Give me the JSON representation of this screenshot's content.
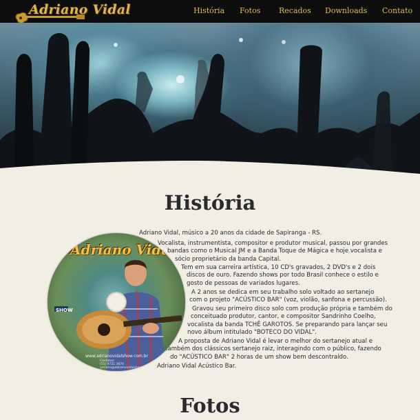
{
  "brand": {
    "name": "Adriano Vidal"
  },
  "nav": {
    "items": [
      {
        "label": "História"
      },
      {
        "label": "Fotos"
      },
      {
        "label": "Recados"
      },
      {
        "label": "Downloads"
      },
      {
        "label": "Contato"
      }
    ]
  },
  "hero": {
    "description": "Concert crowd silhouettes with hands raised, band on stage under lights"
  },
  "historia": {
    "title": "História",
    "intro": "Adriano Vidal, músico a 20 anos da cidade de Sapiranga - RS.",
    "p1": [
      "Vocalista, instrumentista, compositor e produtor musical, passou por grandes",
      "bandas como o Musical JM e a Banda Toque de Mágica e hoje vocalista e",
      "sócio proprietário da banda Capital."
    ],
    "p2": [
      "Tem em sua carreira artística, 10 CD's gravados, 2 DVD's e 2 dois",
      "discos de ouro. Fazendo shows por todo Brasil conhece o estilo e",
      "gosto de pessoas de variados lugares."
    ],
    "p3": [
      "A 2 anos se dedica em seu trabalho solo voltado ao sertanejo",
      "com o projeto \"ACÚSTICO BAR\" (voz, violão, sanfona e percussão)."
    ],
    "p4": [
      "Gravou seu primeiro disco solo com produção própria e também do",
      "conceituado produtor, cantor, e compositor Sandrinho Coelho,",
      "vocalista da banda TCHÊ GAROTOS. Se preparando para lançar seu",
      "novo álbum intitulado \"BOTECO DO VIDAL\"."
    ],
    "p5": [
      "A proposta de Adriano Vidal é levar o melhor do sertanejo atual  e",
      "também dos clássicos sertanejo raiz, interagindo com o público, fazendo",
      "do \"ACÚSTICO BAR\" 2 horas de um show bem descontraído."
    ],
    "outro": "Adriano Vidal Acústico Bar."
  },
  "cd": {
    "title": "Adriano Vidal",
    "url": "www.adrianovidalshow.com.br",
    "contact_label": "Contatos:",
    "phone": "(51) 9721 3674",
    "email": "adriano@adrianovidalshow.com.br",
    "label_left": "SHOW"
  },
  "fotos": {
    "title": "Fotos"
  },
  "colors": {
    "accent": "#e4b94c",
    "nav_bg": "#0d0d0d",
    "page_bg": "#f1eee4",
    "heading": "#2b2b2b"
  }
}
